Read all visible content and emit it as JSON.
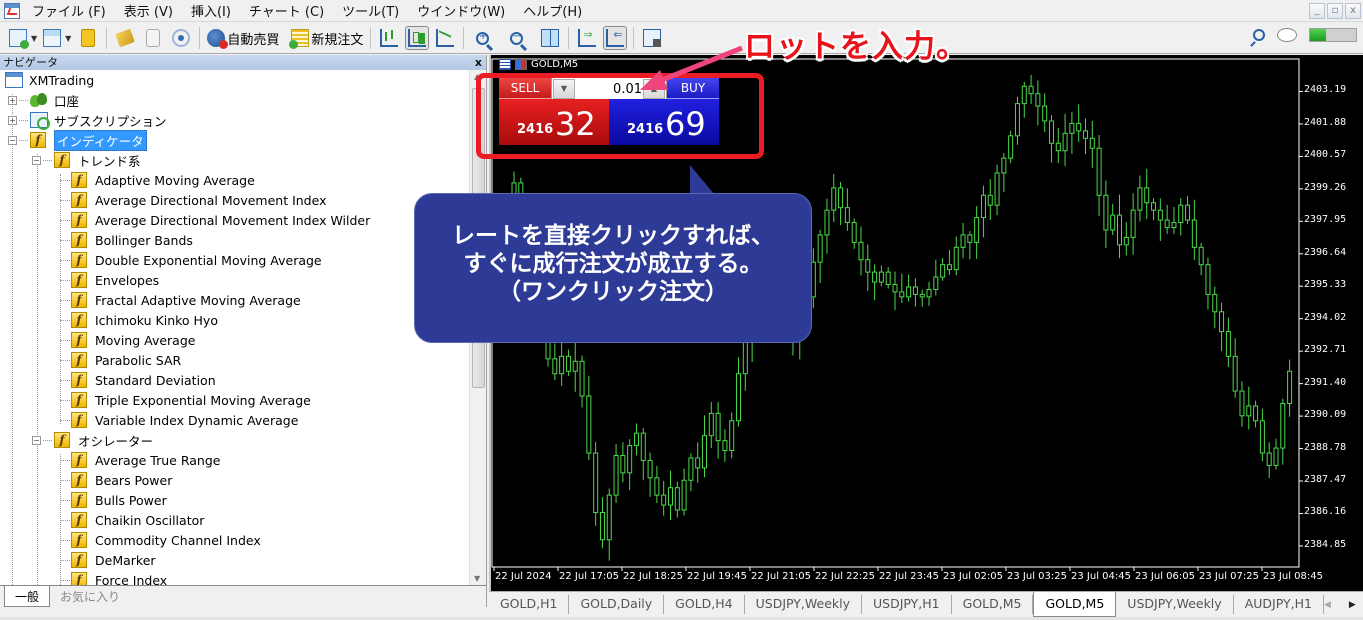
{
  "menubar": {
    "items": [
      "ファイル (F)",
      "表示 (V)",
      "挿入(I)",
      "チャート (C)",
      "ツール(T)",
      "ウインドウ(W)",
      "ヘルプ(H)"
    ],
    "window_controls": [
      "_",
      "▫",
      "x"
    ]
  },
  "toolbar": {
    "auto_trading_label": "自動売買",
    "new_order_label": "新規注文",
    "connection_strength": 0.35
  },
  "annotation": {
    "title": "ロットを入力。",
    "callout_lines": [
      "レートを直接クリックすれば、",
      "すぐに成行注文が成立する。",
      "（ワンクリック注文）"
    ],
    "accent_red": "#ec1c24",
    "callout_color": "#2e3b96"
  },
  "navigator": {
    "title": "ナビゲータ",
    "close": "x",
    "root": "XMTrading",
    "accounts": "口座",
    "subscriptions": "サブスクリプション",
    "indicators": "インディケータ",
    "trend_group": "トレンド系",
    "trend_items": [
      "Adaptive Moving Average",
      "Average Directional Movement Index",
      "Average Directional Movement Index Wilder",
      "Bollinger Bands",
      "Double Exponential Moving Average",
      "Envelopes",
      "Fractal Adaptive Moving Average",
      "Ichimoku Kinko Hyo",
      "Moving Average",
      "Parabolic SAR",
      "Standard Deviation",
      "Triple Exponential Moving Average",
      "Variable Index Dynamic Average"
    ],
    "oscillator_group": "オシレーター",
    "oscillator_items": [
      "Average True Range",
      "Bears Power",
      "Bulls Power",
      "Chaikin Oscillator",
      "Commodity Channel Index",
      "DeMarker",
      "Force Index"
    ],
    "tabs": [
      "一般",
      "お気に入り"
    ]
  },
  "chart": {
    "symbol_title": "GOLD,M5",
    "one_click": {
      "sell_label": "SELL",
      "buy_label": "BUY",
      "lot_value": "0.01",
      "bid_prefix": "2416",
      "bid_suffix": "32",
      "ask_prefix": "2416",
      "ask_suffix": "69"
    },
    "tabs": [
      "GOLD,H1",
      "GOLD,Daily",
      "GOLD,H4",
      "USDJPY,Weekly",
      "USDJPY,H1",
      "GOLD,M5",
      "GOLD,M5",
      "USDJPY,Weekly",
      "AUDJPY,H1"
    ],
    "active_tab_index": 6
  },
  "chart_data": {
    "type": "candlestick",
    "symbol": "GOLD",
    "timeframe": "M5",
    "price_ticks": [
      "2403.19",
      "2401.88",
      "2400.57",
      "2399.26",
      "2397.95",
      "2396.64",
      "2395.33",
      "2394.02",
      "2392.71",
      "2391.40",
      "2390.09",
      "2388.78",
      "2387.47",
      "2386.16",
      "2384.85"
    ],
    "ylim": [
      2384.0,
      2404.5
    ],
    "time_ticks": [
      "22 Jul 2024",
      "22 Jul 17:05",
      "22 Jul 18:25",
      "22 Jul 19:45",
      "22 Jul 21:05",
      "22 Jul 22:25",
      "22 Jul 23:45",
      "23 Jul 02:05",
      "23 Jul 03:25",
      "23 Jul 04:45",
      "23 Jul 06:05",
      "23 Jul 07:25",
      "23 Jul 08:45"
    ],
    "close_series": [
      2397.9,
      2398.8,
      2399.5,
      2398.2,
      2396.5,
      2394.8,
      2393.6,
      2392.4,
      2391.8,
      2392.5,
      2391.9,
      2392.3,
      2390.9,
      2388.6,
      2386.2,
      2385.1,
      2386.9,
      2388.5,
      2387.8,
      2388.9,
      2389.4,
      2388.3,
      2387.6,
      2386.9,
      2386.5,
      2387.2,
      2386.3,
      2387.5,
      2388.4,
      2388.0,
      2389.3,
      2390.2,
      2389.1,
      2388.7,
      2389.9,
      2391.8,
      2393.1,
      2393.8,
      2394.5,
      2395.5,
      2395.2,
      2394.3,
      2393.8,
      2393.2,
      2394.1,
      2394.9,
      2396.3,
      2397.4,
      2398.4,
      2399.3,
      2398.5,
      2397.9,
      2397.1,
      2396.4,
      2395.9,
      2395.5,
      2395.9,
      2395.4,
      2395.1,
      2394.9,
      2395.3,
      2395.0,
      2394.9,
      2395.2,
      2395.7,
      2396.2,
      2396.0,
      2396.9,
      2397.4,
      2397.1,
      2398.1,
      2399.0,
      2398.6,
      2399.9,
      2400.5,
      2401.4,
      2402.7,
      2403.4,
      2403.1,
      2402.6,
      2402.0,
      2401.1,
      2400.8,
      2401.5,
      2401.9,
      2401.6,
      2401.3,
      2400.9,
      2399.0,
      2397.6,
      2398.2,
      2397.0,
      2397.3,
      2398.4,
      2399.3,
      2398.7,
      2398.4,
      2398.0,
      2397.7,
      2397.9,
      2398.6,
      2398.0,
      2396.9,
      2396.2,
      2395.0,
      2394.3,
      2393.5,
      2392.5,
      2391.1,
      2390.1,
      2390.5,
      2389.9,
      2388.6,
      2388.1,
      2388.8,
      2390.6,
      2391.9
    ]
  }
}
